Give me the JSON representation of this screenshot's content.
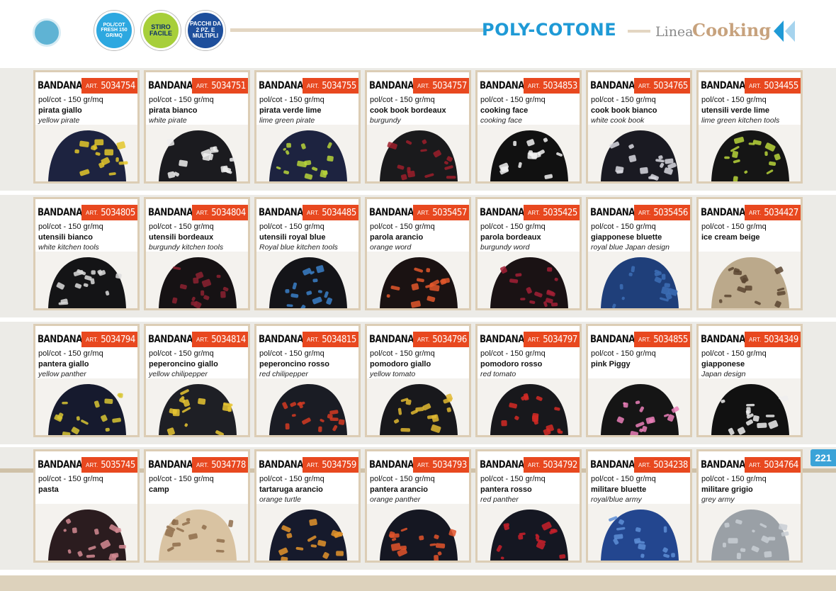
{
  "header": {
    "title": "POLY-COTONE",
    "linea": "Linea",
    "cooking": "Cooking",
    "badges": [
      {
        "text": "POL/COT FRESH 150 GR/MQ"
      },
      {
        "text": "STIRO FACILE"
      },
      {
        "text": "PACCHI DA 2 PZ. E MULTIPLI"
      }
    ]
  },
  "page_number": "221",
  "product_type": "BANDANA",
  "art_prefix": "ART.",
  "colors": {
    "accent_orange": "#e8481f",
    "title_blue": "#1f9ad6",
    "card_border": "#dccdb5"
  },
  "products": [
    {
      "art": "5034754",
      "fabric": "pol/cot - 150 gr/mq",
      "name": "pirata giallo",
      "en": "yellow pirate",
      "base": "#1d2340",
      "print": "#e3c72a"
    },
    {
      "art": "5034751",
      "fabric": "pol/cot - 150 gr/mq",
      "name": "pirata bianco",
      "en": "white pirate",
      "base": "#1b1b1f",
      "print": "#efefef"
    },
    {
      "art": "5034755",
      "fabric": "pol/cot - 150 gr/mq",
      "name": "pirata verde lime",
      "en": "lime green pirate",
      "base": "#1d2340",
      "print": "#b7d33a"
    },
    {
      "art": "5034757",
      "fabric": "pol/cot - 150 gr/mq",
      "name": "cook book bordeaux",
      "en": "burgundy",
      "base": "#1a1a1c",
      "print": "#9e1f2a"
    },
    {
      "art": "5034853",
      "fabric": "pol/cot - 150 gr/mq",
      "name": "cooking face",
      "en": "cooking face",
      "base": "#111111",
      "print": "#f2f2f2"
    },
    {
      "art": "5034765",
      "fabric": "pol/cot - 150 gr/mq",
      "name": "cook book bianco",
      "en": "white cook book",
      "base": "#1a1a22",
      "print": "#d9d9e0"
    },
    {
      "art": "5034455",
      "fabric": "pol/cot - 150 gr/mq",
      "name": "utensili verde lime",
      "en": "lime green kitchen tools",
      "base": "#151515",
      "print": "#b7d33a"
    },
    {
      "art": "5034805",
      "fabric": "pol/cot - 150 gr/mq",
      "name": "utensili bianco",
      "en": "white kitchen tools",
      "base": "#141416",
      "print": "#dcdcdc"
    },
    {
      "art": "5034804",
      "fabric": "pol/cot - 150 gr/mq",
      "name": "utensili bordeaux",
      "en": "burgundy kitchen tools",
      "base": "#161214",
      "print": "#8c2230"
    },
    {
      "art": "5034485",
      "fabric": "pol/cot - 150 gr/mq",
      "name": "utensili royal blue",
      "en": "Royal blue kitchen tools",
      "base": "#141418",
      "print": "#3a7fc8"
    },
    {
      "art": "5035457",
      "fabric": "pol/cot - 150 gr/mq",
      "name": "parola arancio",
      "en": "orange word",
      "base": "#1a1212",
      "print": "#e2572b"
    },
    {
      "art": "5035425",
      "fabric": "pol/cot - 150 gr/mq",
      "name": "parola bordeaux",
      "en": "burgundy word",
      "base": "#1a1214",
      "print": "#a32035"
    },
    {
      "art": "5035456",
      "fabric": "pol/cot - 150 gr/mq",
      "name": "giapponese bluette",
      "en": "royal blue Japan design",
      "base": "#1f3f7a",
      "print": "#3d6fb6"
    },
    {
      "art": "5034427",
      "fabric": "pol/cot - 150 gr/mq",
      "name": "ice cream beige",
      "en": "",
      "base": "#bba98b",
      "print": "#5a4530"
    },
    {
      "art": "5034794",
      "fabric": "pol/cot - 150 gr/mq",
      "name": "pantera giallo",
      "en": "yellow panther",
      "base": "#161a2e",
      "print": "#d8c532"
    },
    {
      "art": "5034814",
      "fabric": "pol/cot - 150 gr/mq",
      "name": "peperoncino giallo",
      "en": "yellow chilipepper",
      "base": "#1e1f25",
      "print": "#e8c531"
    },
    {
      "art": "5034815",
      "fabric": "pol/cot - 150 gr/mq",
      "name": "peperoncino rosso",
      "en": "red chilipepper",
      "base": "#1a1c24",
      "print": "#d43a22"
    },
    {
      "art": "5034796",
      "fabric": "pol/cot - 150 gr/mq",
      "name": "pomodoro giallo",
      "en": "yellow tomato",
      "base": "#18181c",
      "print": "#e0b830"
    },
    {
      "art": "5034797",
      "fabric": "pol/cot - 150 gr/mq",
      "name": "pomodoro rosso",
      "en": "red tomato",
      "base": "#18181c",
      "print": "#d42a25"
    },
    {
      "art": "5034855",
      "fabric": "pol/cot - 150 gr/mq",
      "name": "pink Piggy",
      "en": "",
      "base": "#151515",
      "print": "#ea7fb8"
    },
    {
      "art": "5034349",
      "fabric": "pol/cot - 150 gr/mq",
      "name": "giapponese",
      "en": "Japan design",
      "base": "#111111",
      "print": "#efefef"
    },
    {
      "art": "5035745",
      "fabric": "pol/cot - 150 gr/mq",
      "name": "pasta",
      "en": "",
      "base": "#2b1c1f",
      "print": "#d48a93"
    },
    {
      "art": "5034778",
      "fabric": "pol/cot - 150 gr/mq",
      "name": "camp",
      "en": "",
      "base": "#d9c3a2",
      "print": "#8f6e4c"
    },
    {
      "art": "5034759",
      "fabric": "pol/cot - 150 gr/mq",
      "name": "tartaruga arancio",
      "en": "orange turtle",
      "base": "#161a2c",
      "print": "#e3942b"
    },
    {
      "art": "5034793",
      "fabric": "pol/cot - 150 gr/mq",
      "name": "pantera arancio",
      "en": "orange panther",
      "base": "#151722",
      "print": "#e2532a"
    },
    {
      "art": "5034792",
      "fabric": "pol/cot - 150 gr/mq",
      "name": "pantera rosso",
      "en": "red panther",
      "base": "#151722",
      "print": "#c9202a"
    },
    {
      "art": "5034238",
      "fabric": "pol/cot - 150 gr/mq",
      "name": "militare bluette",
      "en": "royal/blue army",
      "base": "#23468f",
      "print": "#5d8ed6"
    },
    {
      "art": "5034764",
      "fabric": "pol/cot - 150 gr/mq",
      "name": "militare grigio",
      "en": "grey army",
      "base": "#9aa0a6",
      "print": "#c8ced4"
    }
  ]
}
